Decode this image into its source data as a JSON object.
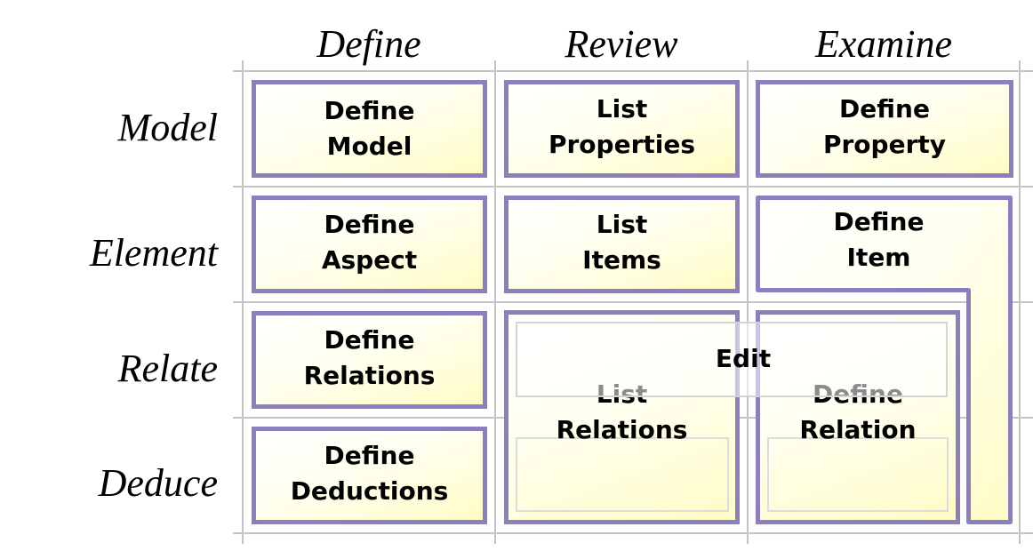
{
  "diagram": {
    "column_headers": [
      "Define",
      "Review",
      "Examine"
    ],
    "row_headers": [
      "Model",
      "Element",
      "Relate",
      "Deduce"
    ],
    "cells": {
      "define_model": [
        "Define",
        "Model"
      ],
      "list_properties": [
        "List",
        "Properties"
      ],
      "define_property": [
        "Define",
        "Property"
      ],
      "define_aspect": [
        "Define",
        "Aspect"
      ],
      "list_items": [
        "List",
        "Items"
      ],
      "define_item": [
        "Define",
        "Item"
      ],
      "define_relations": [
        "Define",
        "Relations"
      ],
      "list_relations": [
        "List",
        "Relations"
      ],
      "define_relation": [
        "Define",
        "Relation"
      ],
      "define_deductions": [
        "Define",
        "Deductions"
      ]
    },
    "overlay_label": "Edit",
    "colors": {
      "box_border": "#8b80bd",
      "box_fill_light": "#ffffff",
      "box_fill_dark": "#fffcc6",
      "grid": "#c3c3c3"
    }
  }
}
